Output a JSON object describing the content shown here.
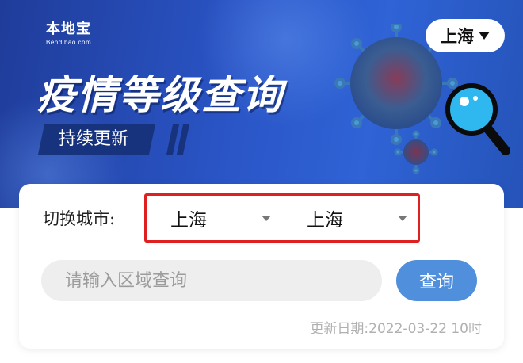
{
  "banner": {
    "logo_text": "本地宝",
    "logo_sub": "Bendibao.com",
    "headline": "疫情等级查询",
    "subtag": "持续更新",
    "city_button": "上海",
    "colors": {
      "banner": "#2a55c6",
      "tag": "#17337e"
    }
  },
  "card": {
    "switch_label": "切换城市:",
    "select_province": {
      "value": "上海"
    },
    "select_city": {
      "value": "上海"
    },
    "search": {
      "placeholder": "请输入区域查询",
      "button_label": "查询"
    },
    "update_text": "更新日期:2022-03-22 10时",
    "colors": {
      "highlight_border": "#e02020",
      "button": "#4f8fdc"
    }
  }
}
